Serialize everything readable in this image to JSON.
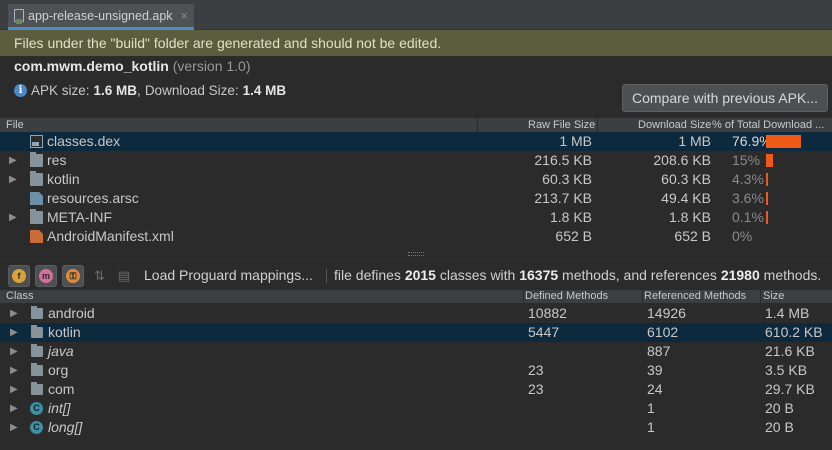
{
  "tab": {
    "label": "app-release-unsigned.apk",
    "close": "×"
  },
  "banner": "Files under the \"build\" folder are generated and should not be edited.",
  "package": {
    "name": "com.mwm.demo_kotlin",
    "version_text": "(version 1.0)"
  },
  "sizes": {
    "apk_label": "APK size:",
    "apk_value": "1.6 MB",
    "sep": ",",
    "download_label": "Download Size:",
    "download_value": "1.4 MB"
  },
  "compare_button": "Compare with previous APK...",
  "file_table": {
    "headers": [
      "File",
      "Raw File Size",
      "Download Size",
      "% of Total Download ..."
    ],
    "rows": [
      {
        "name": "classes.dex",
        "raw": "1 MB",
        "download": "1 MB",
        "pct": "76.9%",
        "pct_value": 76.9,
        "icon": "dex-file-icon",
        "expandable": false,
        "selected": true
      },
      {
        "name": "res",
        "raw": "216.5 KB",
        "download": "208.6 KB",
        "pct": "15%",
        "pct_value": 15,
        "icon": "folder-icon",
        "expandable": true,
        "selected": false
      },
      {
        "name": "kotlin",
        "raw": "60.3 KB",
        "download": "60.3 KB",
        "pct": "4.3%",
        "pct_value": 4.3,
        "icon": "folder-icon",
        "expandable": true,
        "selected": false
      },
      {
        "name": "resources.arsc",
        "raw": "213.7 KB",
        "download": "49.4 KB",
        "pct": "3.6%",
        "pct_value": 3.6,
        "icon": "arsc-file-icon",
        "expandable": false,
        "selected": false
      },
      {
        "name": "META-INF",
        "raw": "1.8 KB",
        "download": "1.8 KB",
        "pct": "0.1%",
        "pct_value": 0.1,
        "icon": "folder-icon",
        "expandable": true,
        "selected": false
      },
      {
        "name": "AndroidManifest.xml",
        "raw": "652 B",
        "download": "652 B",
        "pct": "0%",
        "pct_value": 0,
        "icon": "xml-file-icon",
        "expandable": false,
        "selected": false
      }
    ]
  },
  "toolbar": {
    "buttons": [
      {
        "icon": "f-icon",
        "glyph": "f",
        "color": "#d9a23a"
      },
      {
        "icon": "m-icon",
        "glyph": "m",
        "color": "#d26f9a"
      },
      {
        "icon": "lock-icon",
        "glyph": "🔒",
        "color": "#e08a3c"
      }
    ],
    "load_label": "Load Proguard mappings...",
    "stats": {
      "t1": "file defines ",
      "classes": "2015",
      "t2": " classes with ",
      "methods": "16375",
      "t3": " methods, and references ",
      "references": "21980",
      "t4": " methods."
    }
  },
  "class_table": {
    "headers": [
      "Class",
      "Defined Methods",
      "Referenced Methods",
      "Size"
    ],
    "rows": [
      {
        "name": "android",
        "defined": "10882",
        "referenced": "14926",
        "size": "1.4 MB",
        "icon": "package-icon",
        "italic": false,
        "selected": false
      },
      {
        "name": "kotlin",
        "defined": "5447",
        "referenced": "6102",
        "size": "610.2 KB",
        "icon": "package-icon",
        "italic": false,
        "selected": true
      },
      {
        "name": "java",
        "defined": "",
        "referenced": "887",
        "size": "21.6 KB",
        "icon": "package-icon",
        "italic": true,
        "selected": false
      },
      {
        "name": "org",
        "defined": "23",
        "referenced": "39",
        "size": "3.5 KB",
        "icon": "package-icon",
        "italic": false,
        "selected": false
      },
      {
        "name": "com",
        "defined": "23",
        "referenced": "24",
        "size": "29.7 KB",
        "icon": "package-icon",
        "italic": false,
        "selected": false
      },
      {
        "name": "int[]",
        "defined": "",
        "referenced": "1",
        "size": "20 B",
        "icon": "class-icon",
        "italic": true,
        "selected": false
      },
      {
        "name": "long[]",
        "defined": "",
        "referenced": "1",
        "size": "20 B",
        "icon": "class-icon",
        "italic": true,
        "selected": false
      }
    ]
  },
  "colors": {
    "accent": "#4a88c7",
    "bar": "#ee5a18",
    "selection": "#0d293e",
    "banner": "#5c5c3e"
  }
}
